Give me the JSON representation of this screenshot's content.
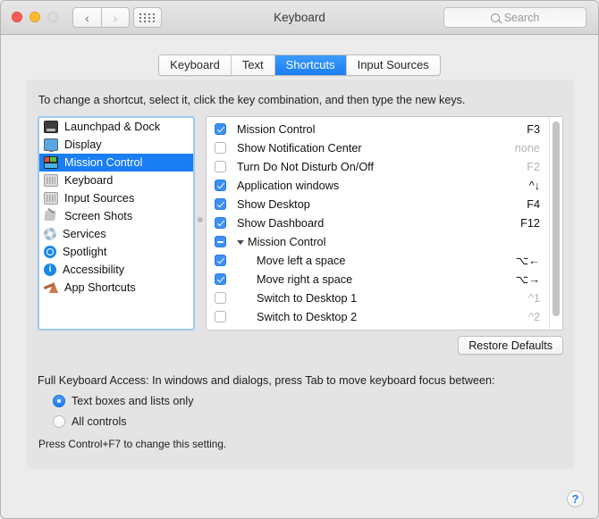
{
  "window": {
    "title": "Keyboard",
    "traffic": {
      "close": "close-button",
      "minimize": "minimize-button",
      "zoom": "zoom-button"
    },
    "nav": {
      "back": "‹",
      "forward": "›"
    },
    "grid_button": "show-all-button"
  },
  "search": {
    "placeholder": "Search"
  },
  "tabs": [
    {
      "label": "Keyboard",
      "active": false
    },
    {
      "label": "Text",
      "active": false
    },
    {
      "label": "Shortcuts",
      "active": true
    },
    {
      "label": "Input Sources",
      "active": false
    }
  ],
  "hint": "To change a shortcut, select it, click the key combination, and then type the new keys.",
  "sidebar": {
    "items": [
      {
        "label": "Launchpad & Dock",
        "icon": "launchpad-dock-icon",
        "selected": false
      },
      {
        "label": "Display",
        "icon": "display-icon",
        "selected": false
      },
      {
        "label": "Mission Control",
        "icon": "mission-control-icon",
        "selected": true
      },
      {
        "label": "Keyboard",
        "icon": "keyboard-icon",
        "selected": false
      },
      {
        "label": "Input Sources",
        "icon": "input-sources-icon",
        "selected": false
      },
      {
        "label": "Screen Shots",
        "icon": "screen-shots-icon",
        "selected": false
      },
      {
        "label": "Services",
        "icon": "services-icon",
        "selected": false
      },
      {
        "label": "Spotlight",
        "icon": "spotlight-icon",
        "selected": false
      },
      {
        "label": "Accessibility",
        "icon": "accessibility-icon",
        "selected": false
      },
      {
        "label": "App Shortcuts",
        "icon": "app-shortcuts-icon",
        "selected": false
      }
    ]
  },
  "shortcuts": {
    "rows": [
      {
        "label": "Mission Control",
        "key": "F3",
        "state": "checked",
        "dim": false,
        "indent": false,
        "group": false
      },
      {
        "label": "Show Notification Center",
        "key": "none",
        "state": "unchecked",
        "dim": true,
        "indent": false,
        "group": false
      },
      {
        "label": "Turn Do Not Disturb On/Off",
        "key": "F2",
        "state": "unchecked",
        "dim": true,
        "indent": false,
        "group": false
      },
      {
        "label": "Application windows",
        "key": "^↓",
        "state": "checked",
        "dim": false,
        "indent": false,
        "group": false
      },
      {
        "label": "Show Desktop",
        "key": "F4",
        "state": "checked",
        "dim": false,
        "indent": false,
        "group": false
      },
      {
        "label": "Show Dashboard",
        "key": "F12",
        "state": "checked",
        "dim": false,
        "indent": false,
        "group": false
      },
      {
        "label": "Mission Control",
        "key": "",
        "state": "mixed",
        "dim": false,
        "indent": false,
        "group": true
      },
      {
        "label": "Move left a space",
        "key": "⌥←",
        "state": "checked",
        "dim": false,
        "indent": true,
        "group": false
      },
      {
        "label": "Move right a space",
        "key": "⌥→",
        "state": "checked",
        "dim": false,
        "indent": true,
        "group": false
      },
      {
        "label": "Switch to Desktop 1",
        "key": "^1",
        "state": "unchecked",
        "dim": true,
        "indent": true,
        "group": false
      },
      {
        "label": "Switch to Desktop 2",
        "key": "^2",
        "state": "unchecked",
        "dim": true,
        "indent": true,
        "group": false
      }
    ]
  },
  "restore_defaults_label": "Restore Defaults",
  "full_keyboard_access": {
    "label": "Full Keyboard Access: In windows and dialogs, press Tab to move keyboard focus between:",
    "options": [
      {
        "label": "Text boxes and lists only",
        "selected": true
      },
      {
        "label": "All controls",
        "selected": false
      }
    ],
    "note": "Press Control+F7 to change this setting."
  },
  "help_label": "?",
  "colors": {
    "accent": "#1a7ef4",
    "selection": "#1a7ef4",
    "window_bg": "#ececec",
    "panel_bg": "#e4e4e4",
    "dim_text": "#b5b5b5"
  }
}
